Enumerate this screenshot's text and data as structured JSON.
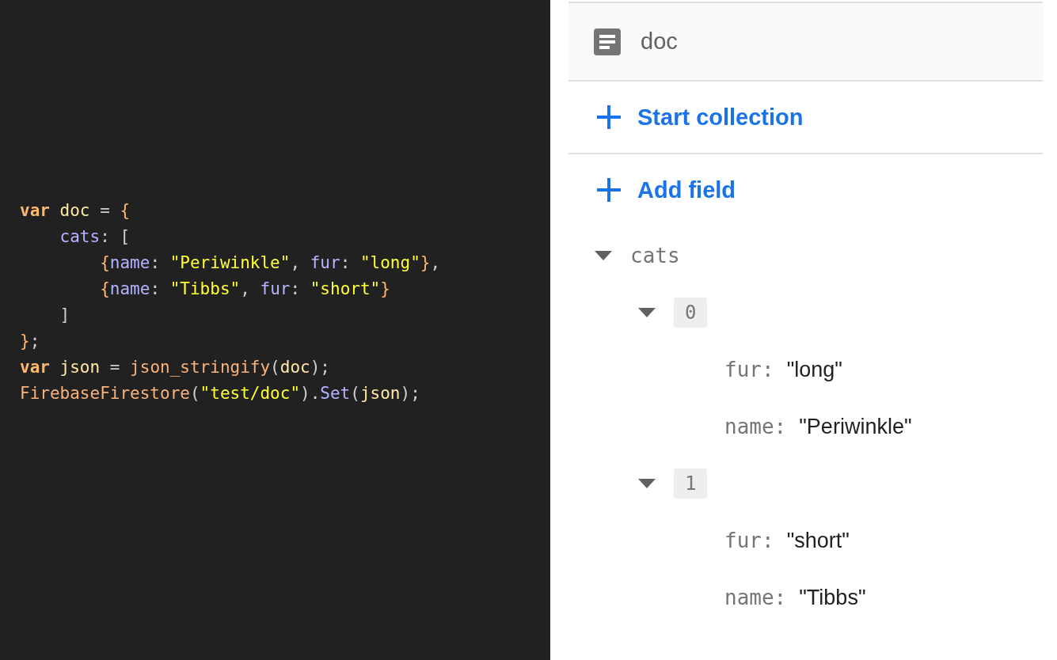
{
  "code": {
    "lines": [
      [
        {
          "text": "var ",
          "kind": "keyword"
        },
        {
          "text": "doc",
          "kind": "ident"
        },
        {
          "text": " = ",
          "kind": "punct"
        },
        {
          "text": "{",
          "kind": "brace"
        }
      ],
      [
        {
          "text": "    cats",
          "kind": "prop"
        },
        {
          "text": ": [",
          "kind": "punct"
        }
      ],
      [
        {
          "text": "        {",
          "kind": "brace"
        },
        {
          "text": "name",
          "kind": "prop"
        },
        {
          "text": ": ",
          "kind": "punct"
        },
        {
          "text": "\"Periwinkle\"",
          "kind": "string"
        },
        {
          "text": ", ",
          "kind": "punct"
        },
        {
          "text": "fur",
          "kind": "prop"
        },
        {
          "text": ": ",
          "kind": "punct"
        },
        {
          "text": "\"long\"",
          "kind": "string"
        },
        {
          "text": "}",
          "kind": "brace"
        },
        {
          "text": ",",
          "kind": "punct"
        }
      ],
      [
        {
          "text": "        {",
          "kind": "brace"
        },
        {
          "text": "name",
          "kind": "prop"
        },
        {
          "text": ": ",
          "kind": "punct"
        },
        {
          "text": "\"Tibbs\"",
          "kind": "string"
        },
        {
          "text": ", ",
          "kind": "punct"
        },
        {
          "text": "fur",
          "kind": "prop"
        },
        {
          "text": ": ",
          "kind": "punct"
        },
        {
          "text": "\"short\"",
          "kind": "string"
        },
        {
          "text": "}",
          "kind": "brace"
        }
      ],
      [
        {
          "text": "    ]",
          "kind": "punct"
        }
      ],
      [
        {
          "text": "}",
          "kind": "brace"
        },
        {
          "text": ";",
          "kind": "punct"
        }
      ],
      [
        {
          "text": "var ",
          "kind": "keyword"
        },
        {
          "text": "json",
          "kind": "ident"
        },
        {
          "text": " = ",
          "kind": "punct"
        },
        {
          "text": "json_stringify",
          "kind": "func"
        },
        {
          "text": "(",
          "kind": "punct"
        },
        {
          "text": "doc",
          "kind": "ident"
        },
        {
          "text": ");",
          "kind": "punct"
        }
      ],
      [
        {
          "text": "FirebaseFirestore",
          "kind": "func"
        },
        {
          "text": "(",
          "kind": "punct"
        },
        {
          "text": "\"test/doc\"",
          "kind": "string"
        },
        {
          "text": ").",
          "kind": "punct"
        },
        {
          "text": "Set",
          "kind": "prop"
        },
        {
          "text": "(",
          "kind": "punct"
        },
        {
          "text": "json",
          "kind": "ident"
        },
        {
          "text": ");",
          "kind": "punct"
        }
      ]
    ]
  },
  "document": {
    "title": "doc",
    "actions": [
      "Start collection",
      "Add field"
    ],
    "fields": [
      {
        "kind": "map",
        "key": "cats",
        "expanded": true,
        "children": [
          {
            "kind": "index",
            "key": "0",
            "expanded": true,
            "children": [
              {
                "kind": "field",
                "key": "fur:",
                "value": "\"long\""
              },
              {
                "kind": "field",
                "key": "name:",
                "value": "\"Periwinkle\""
              }
            ]
          },
          {
            "kind": "index",
            "key": "1",
            "expanded": true,
            "children": [
              {
                "kind": "field",
                "key": "fur:",
                "value": "\"short\""
              },
              {
                "kind": "field",
                "key": "name:",
                "value": "\"Tibbs\""
              }
            ]
          }
        ]
      }
    ]
  }
}
